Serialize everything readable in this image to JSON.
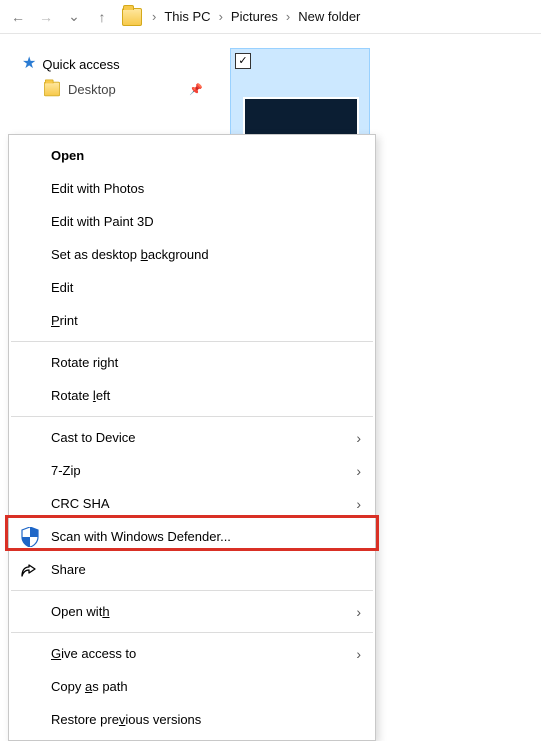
{
  "nav": {
    "crumb1": "This PC",
    "crumb2": "Pictures",
    "crumb3": "New folder",
    "sep": "›"
  },
  "sidebar": {
    "quick_access": "Quick access",
    "desktop_partial": "Desktop"
  },
  "contextmenu": {
    "open": "Open",
    "edit_photos": "Edit with Photos",
    "edit_paint3d": "Edit with Paint 3D",
    "set_bg_pre": "Set as desktop ",
    "set_bg_u": "b",
    "set_bg_post": "ackground",
    "edit": "Edit",
    "print_u": "P",
    "print_post": "rint",
    "rotate_right_pre": "Rotate ri",
    "rotate_right_u": "g",
    "rotate_right_post": "ht",
    "rotate_left_pre": "Rotate ",
    "rotate_left_u": "l",
    "rotate_left_post": "eft",
    "cast": "Cast to Device",
    "sevenzip": "7-Zip",
    "crc": "CRC SHA",
    "defender": "Scan with Windows Defender...",
    "share": "Share",
    "open_with_pre": "Open wit",
    "open_with_u": "h",
    "give_access_u": "G",
    "give_access_post": "ive access to",
    "copy_as_path_pre": "Copy ",
    "copy_as_path_u": "a",
    "copy_as_path_post": "s path",
    "restore_prev_pre": "Restore pre",
    "restore_prev_u": "v",
    "restore_prev_post": "ious versions"
  }
}
